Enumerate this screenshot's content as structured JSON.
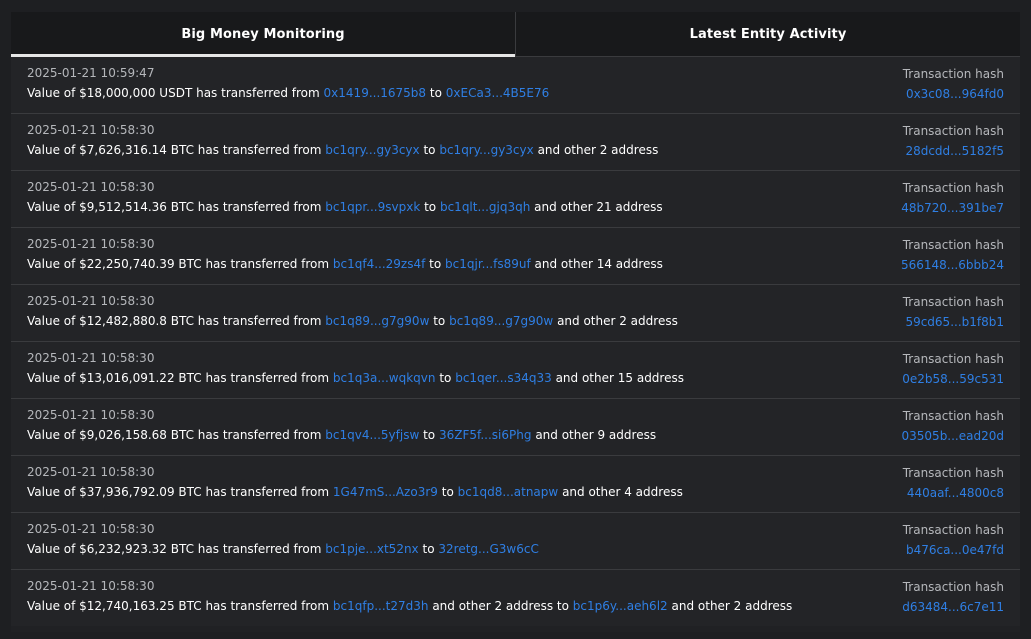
{
  "tabs": [
    {
      "label": "Big Money Monitoring",
      "active": true
    },
    {
      "label": "Latest Entity Activity",
      "active": false
    }
  ],
  "hash_label": "Transaction hash",
  "rows": [
    {
      "time": "2025-01-21 10:59:47",
      "prefix": "Value of $18,000,000 USDT has transferred from",
      "from": "0x1419...1675b8",
      "mid": "to",
      "to": "0xECa3...4B5E76",
      "suffix": "",
      "hash": "0x3c08...964fd0"
    },
    {
      "time": "2025-01-21 10:58:30",
      "prefix": "Value of $7,626,316.14 BTC has transferred from",
      "from": "bc1qry...gy3cyx",
      "mid": "to",
      "to": "bc1qry...gy3cyx",
      "suffix": "and other 2 address",
      "hash": "28dcdd...5182f5"
    },
    {
      "time": "2025-01-21 10:58:30",
      "prefix": "Value of $9,512,514.36 BTC has transferred from",
      "from": "bc1qpr...9svpxk",
      "mid": "to",
      "to": "bc1qlt...gjq3qh",
      "suffix": "and other 21 address",
      "hash": "48b720...391be7"
    },
    {
      "time": "2025-01-21 10:58:30",
      "prefix": "Value of $22,250,740.39 BTC has transferred from",
      "from": "bc1qf4...29zs4f",
      "mid": "to",
      "to": "bc1qjr...fs89uf",
      "suffix": "and other 14 address",
      "hash": "566148...6bbb24"
    },
    {
      "time": "2025-01-21 10:58:30",
      "prefix": "Value of $12,482,880.8 BTC has transferred from",
      "from": "bc1q89...g7g90w",
      "mid": "to",
      "to": "bc1q89...g7g90w",
      "suffix": "and other 2 address",
      "hash": "59cd65...b1f8b1"
    },
    {
      "time": "2025-01-21 10:58:30",
      "prefix": "Value of $13,016,091.22 BTC has transferred from",
      "from": "bc1q3a...wqkqvn",
      "mid": "to",
      "to": "bc1qer...s34q33",
      "suffix": "and other 15 address",
      "hash": "0e2b58...59c531"
    },
    {
      "time": "2025-01-21 10:58:30",
      "prefix": "Value of $9,026,158.68 BTC has transferred from",
      "from": "bc1qv4...5yfjsw",
      "mid": "to",
      "to": "36ZF5f...si6Phg",
      "suffix": "and other 9 address",
      "hash": "03505b...ead20d"
    },
    {
      "time": "2025-01-21 10:58:30",
      "prefix": "Value of $37,936,792.09 BTC has transferred from",
      "from": "1G47mS...Azo3r9",
      "mid": "to",
      "to": "bc1qd8...atnapw",
      "suffix": "and other 4 address",
      "hash": "440aaf...4800c8"
    },
    {
      "time": "2025-01-21 10:58:30",
      "prefix": "Value of $6,232,923.32 BTC has transferred from",
      "from": "bc1pje...xt52nx",
      "mid": "to",
      "to": "32retg...G3w6cC",
      "suffix": "",
      "hash": "b476ca...0e47fd"
    },
    {
      "time": "2025-01-21 10:58:30",
      "prefix": "Value of $12,740,163.25 BTC has transferred from",
      "from": "bc1qfp...t27d3h",
      "mid": "and other 2 address to",
      "to": "bc1p6y...aeh6l2",
      "suffix": "and other 2 address",
      "hash": "d63484...6c7e11"
    }
  ],
  "colors": {
    "background": "#1e1f22",
    "panel": "#232427",
    "link": "#2f7fe4",
    "muted": "#b5b7bb"
  }
}
